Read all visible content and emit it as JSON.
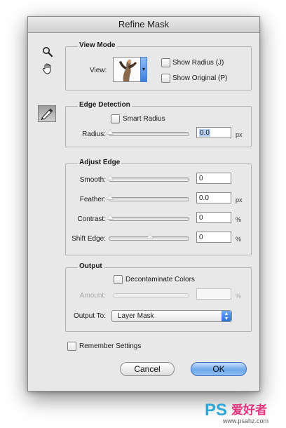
{
  "dialog": {
    "title": "Refine Mask"
  },
  "tools": {
    "zoom_icon": "magnifier-icon",
    "hand_icon": "hand-icon",
    "brush_icon": "refine-radius-brush-icon"
  },
  "view_mode": {
    "title": "View Mode",
    "view_label": "View:",
    "show_radius": {
      "label": "Show Radius (J)",
      "checked": false
    },
    "show_original": {
      "label": "Show Original (P)",
      "checked": false
    }
  },
  "edge_detection": {
    "title": "Edge Detection",
    "smart_radius": {
      "label": "Smart Radius",
      "checked": false
    },
    "radius": {
      "label": "Radius:",
      "value": "0.0",
      "unit": "px",
      "level": 0
    }
  },
  "adjust_edge": {
    "title": "Adjust Edge",
    "smooth": {
      "label": "Smooth:",
      "value": "0",
      "unit": "",
      "level": 0
    },
    "feather": {
      "label": "Feather:",
      "value": "0.0",
      "unit": "px",
      "level": 0
    },
    "contrast": {
      "label": "Contrast:",
      "value": "0",
      "unit": "%",
      "level": 0
    },
    "shift_edge": {
      "label": "Shift Edge:",
      "value": "0",
      "unit": "%",
      "level": 0.5
    }
  },
  "output": {
    "title": "Output",
    "decontaminate": {
      "label": "Decontaminate Colors",
      "checked": false
    },
    "amount": {
      "label": "Amount:",
      "value": "",
      "unit": "%",
      "enabled": false
    },
    "output_to": {
      "label": "Output To:",
      "value": "Layer Mask"
    }
  },
  "remember": {
    "label": "Remember Settings",
    "checked": false
  },
  "buttons": {
    "cancel": "Cancel",
    "ok": "OK"
  },
  "watermark": {
    "logo": "PS",
    "brand": "爱好者",
    "url": "www.psahz.com"
  },
  "colors": {
    "accent": "#2b6fd7",
    "dialog_bg": "#e8e8e8"
  }
}
